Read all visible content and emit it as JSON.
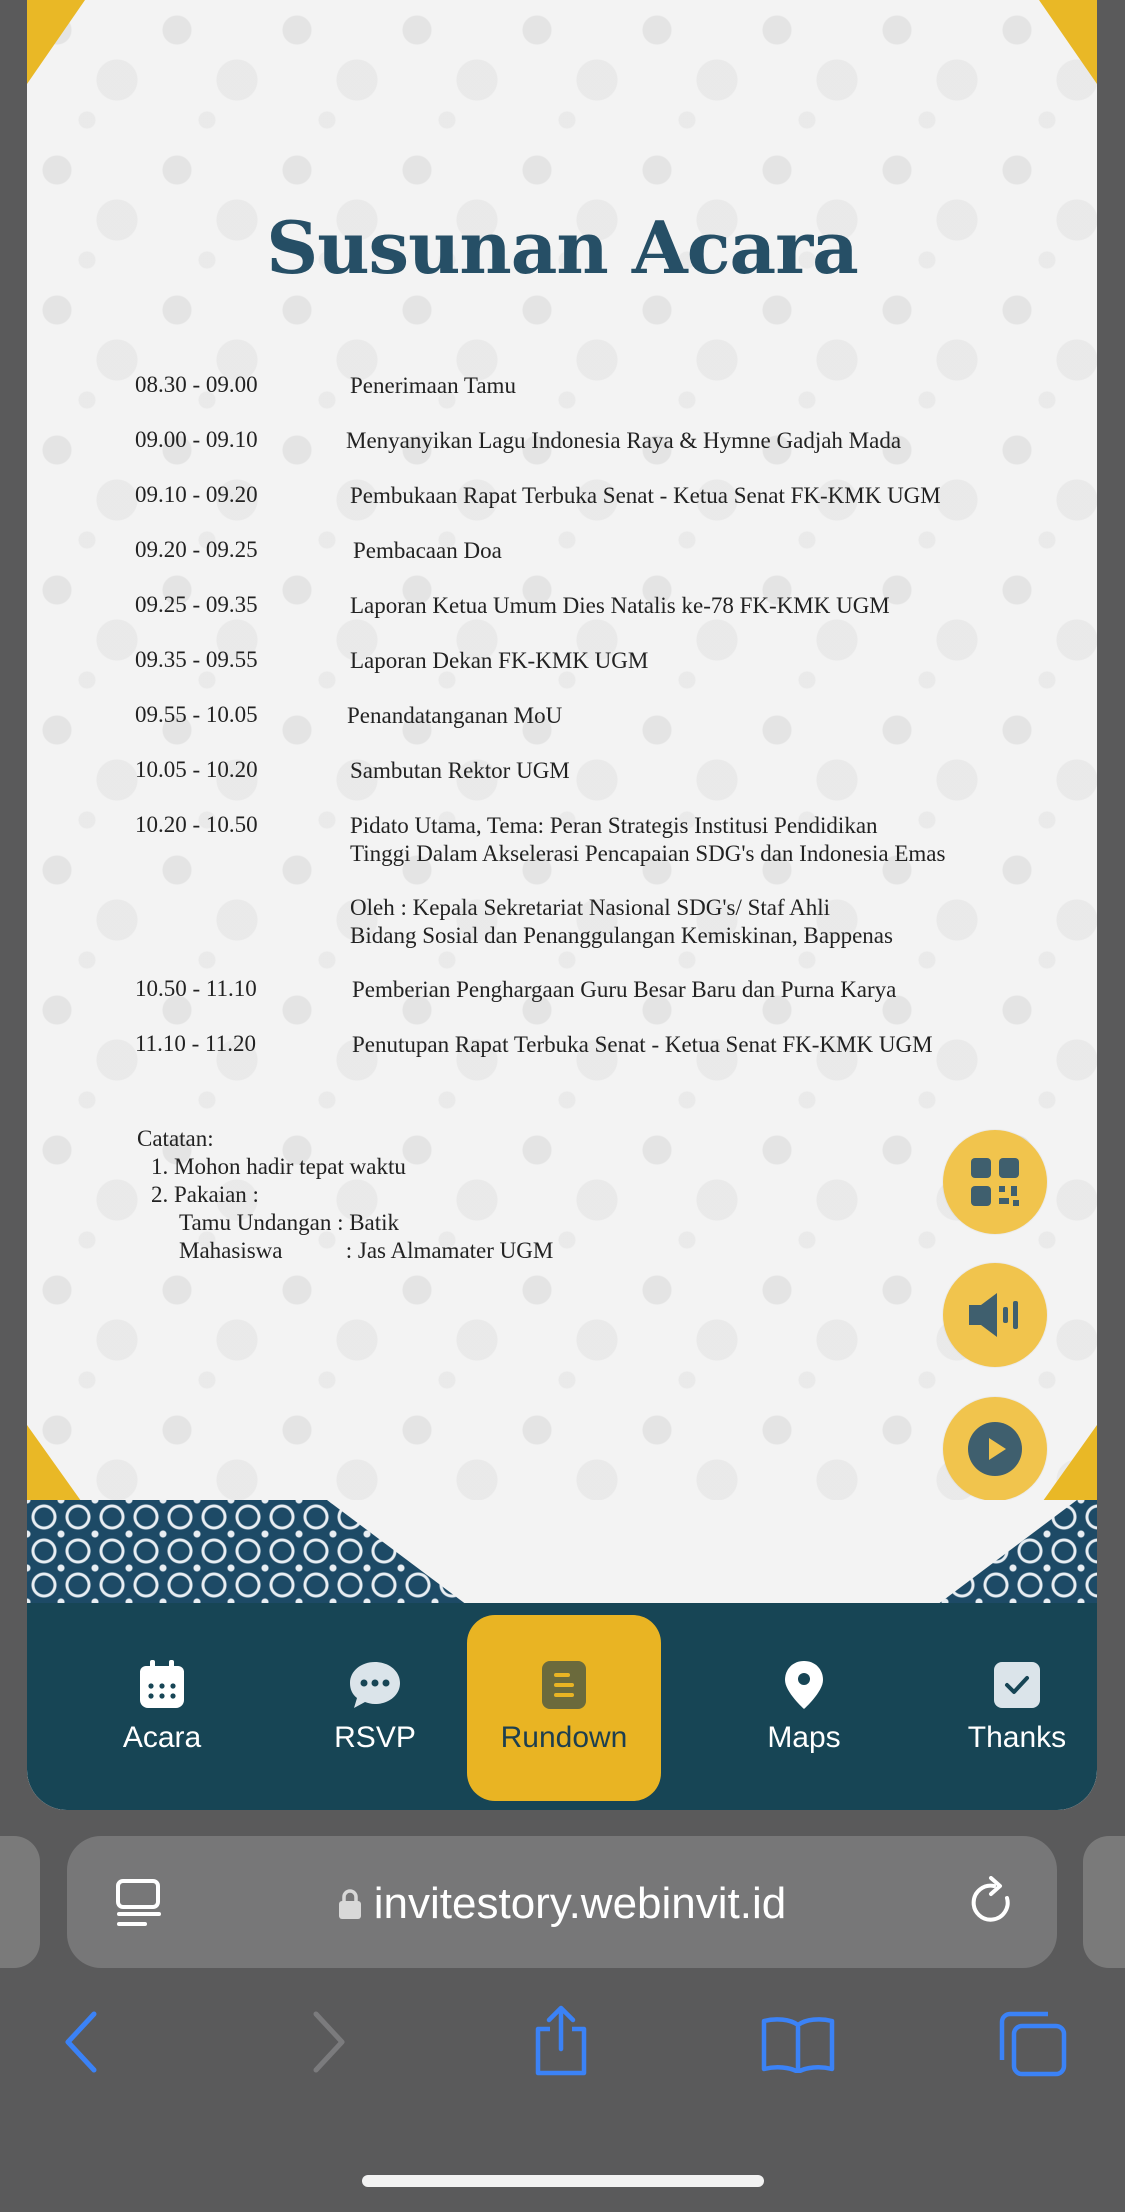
{
  "invitation": {
    "title": "Susunan Acara",
    "rundown": [
      {
        "time": "08.30 - 09.00",
        "activity": [
          "Penerimaan Tamu"
        ]
      },
      {
        "time": "09.00 - 09.10",
        "activity": [
          "Menyanyikan Lagu Indonesia Raya & Hymne Gadjah Mada"
        ]
      },
      {
        "time": "09.10 - 09.20",
        "activity": [
          "Pembukaan Rapat Terbuka Senat - Ketua Senat FK-KMK UGM"
        ]
      },
      {
        "time": "09.20 - 09.25",
        "activity": [
          "Pembacaan Doa"
        ]
      },
      {
        "time": "09.25 - 09.35",
        "activity": [
          "Laporan Ketua Umum Dies Natalis ke-78 FK-KMK UGM"
        ]
      },
      {
        "time": "09.35 - 09.55",
        "activity": [
          "Laporan Dekan FK-KMK UGM"
        ]
      },
      {
        "time": "09.55 - 10.05",
        "activity": [
          "Penandatanganan MoU"
        ]
      },
      {
        "time": "10.05 - 10.20",
        "activity": [
          "Sambutan Rektor UGM"
        ]
      },
      {
        "time": "10.20 - 10.50",
        "activity": [
          "Pidato Utama, Tema: Peran Strategis Institusi Pendidikan",
          "Tinggi Dalam Akselerasi Pencapaian SDG's dan Indonesia Emas"
        ]
      },
      {
        "time": "",
        "activity": [
          "Oleh : Kepala Sekretariat Nasional SDG's/ Staf Ahli",
          "Bidang Sosial dan Penanggulangan Kemiskinan, Bappenas"
        ]
      },
      {
        "time": "10.50 - 11.10",
        "activity": [
          "Pemberian Penghargaan Guru Besar Baru dan Purna Karya"
        ]
      },
      {
        "time": "11.10 - 11.20",
        "activity": [
          "Penutupan Rapat Terbuka Senat - Ketua Senat FK-KMK UGM"
        ]
      }
    ],
    "notes": {
      "heading": "Catatan:",
      "line1": "1. Mohon hadir tepat waktu",
      "line2": "2. Pakaian :",
      "line3": "Tamu Undangan : Batik",
      "line4": "Mahasiswa           : Jas Almamater UGM"
    },
    "fab_icons": [
      "qr-code-icon",
      "speaker-icon",
      "play-icon"
    ]
  },
  "nav": {
    "items": [
      {
        "label": "Acara",
        "icon": "calendar-icon"
      },
      {
        "label": "RSVP",
        "icon": "chat-bubble-icon"
      },
      {
        "label": "Rundown",
        "icon": "document-icon",
        "active": true
      },
      {
        "label": "Maps",
        "icon": "map-pin-icon"
      },
      {
        "label": "Thanks",
        "icon": "checkbox-icon"
      }
    ]
  },
  "browser": {
    "url": "invitestory.webinvit.id"
  },
  "colors": {
    "accent": "#e9b423",
    "nav_bg": "#174555",
    "title": "#264f66",
    "browser_bg": "#5a5a5b",
    "ios_blue": "#3b82f6"
  }
}
